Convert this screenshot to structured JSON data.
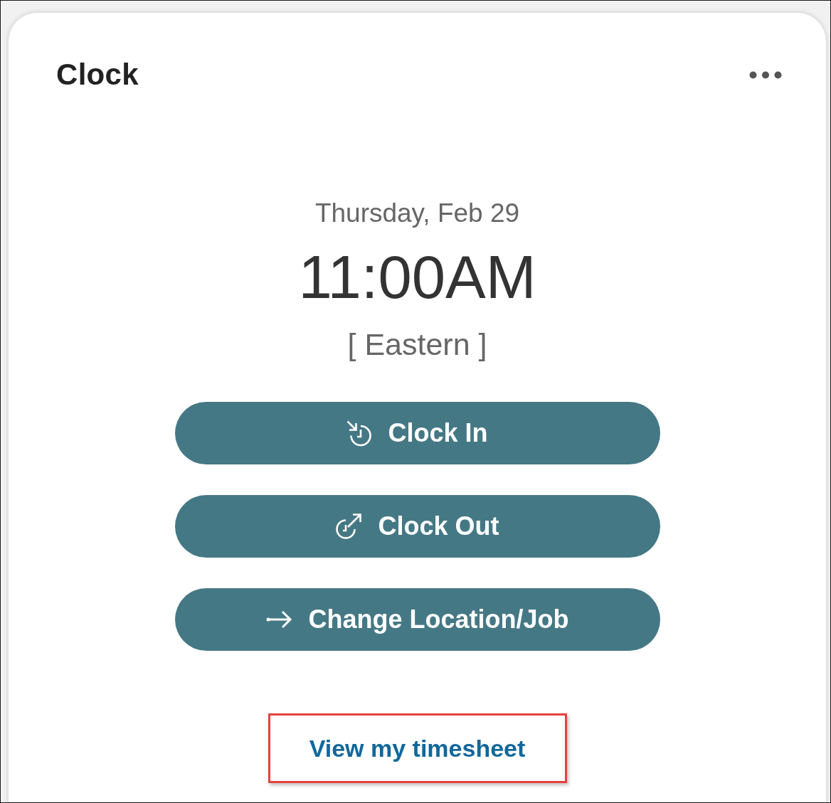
{
  "card": {
    "title": "Clock"
  },
  "clock": {
    "date": "Thursday, Feb 29",
    "time": "11:00AM",
    "timezone": "[ Eastern ]"
  },
  "actions": [
    {
      "kind": "clock-in",
      "label": "Clock In"
    },
    {
      "kind": "clock-out",
      "label": "Clock Out"
    },
    {
      "kind": "change",
      "label": "Change Location/Job"
    }
  ],
  "link": {
    "label": "View my timesheet",
    "highlighted": true
  }
}
